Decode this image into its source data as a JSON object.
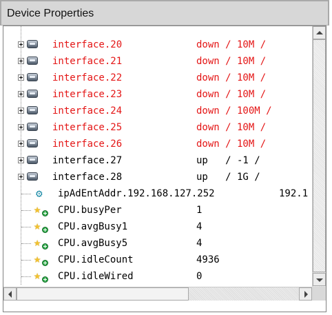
{
  "panel": {
    "title": "Device Properties"
  },
  "interfaces": [
    {
      "name": "interface.20",
      "value": "down / 10M /",
      "color": "#e41515"
    },
    {
      "name": "interface.21",
      "value": "down / 10M /",
      "color": "#e41515"
    },
    {
      "name": "interface.22",
      "value": "down / 10M /",
      "color": "#e41515"
    },
    {
      "name": "interface.23",
      "value": "down / 10M /",
      "color": "#e41515"
    },
    {
      "name": "interface.24",
      "value": "down / 100M /",
      "color": "#e41515"
    },
    {
      "name": "interface.25",
      "value": "down / 10M /",
      "color": "#e41515"
    },
    {
      "name": "interface.26",
      "value": "down / 10M /",
      "color": "#e41515"
    },
    {
      "name": "interface.27",
      "value": "up   / -1 /",
      "color": "#000000"
    },
    {
      "name": "interface.28",
      "value": "up   / 1G /",
      "color": "#000000"
    }
  ],
  "ip_entry": {
    "name": "ipAdEntAddr.192.168.127.252",
    "value": "192.1"
  },
  "cpu_props": [
    {
      "name": "CPU.busyPer",
      "value": "1"
    },
    {
      "name": "CPU.avgBusy1",
      "value": "4"
    },
    {
      "name": "CPU.avgBusy5",
      "value": "4"
    },
    {
      "name": "CPU.idleCount",
      "value": "4936"
    },
    {
      "name": "CPU.idleWired",
      "value": "0"
    }
  ],
  "icons": {
    "expand": "expand-plus-icon",
    "device": "network-interface-icon",
    "ip": "gear-icon",
    "property": "star-property-icon"
  }
}
